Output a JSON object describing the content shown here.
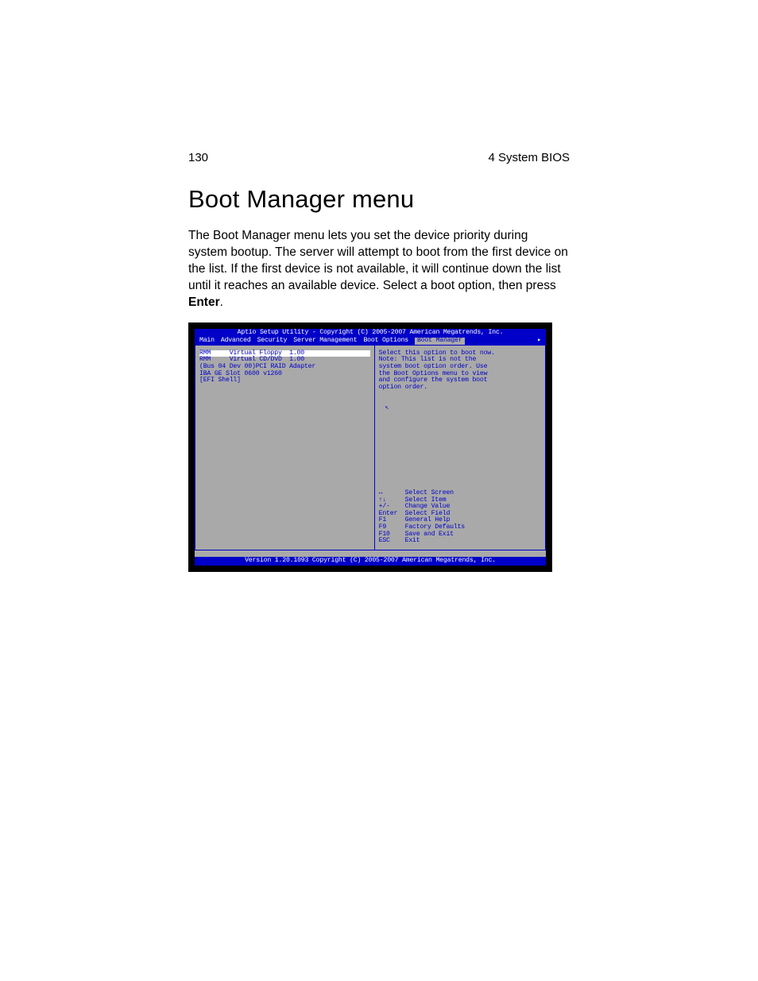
{
  "page": {
    "number": "130",
    "section": "4 System BIOS",
    "heading": "Boot Manager menu",
    "paragraph_pre": "The Boot Manager menu lets you set the device priority during system bootup. The server will attempt to boot from the first device on the list. If the first device is not available, it will continue down the list until it reaches an available device. Select a boot option, then press ",
    "paragraph_bold": "Enter",
    "paragraph_post": "."
  },
  "bios": {
    "title": "Aptio Setup Utility - Copyright (C) 2005-2007 American Megatrends, Inc.",
    "menu": {
      "items": [
        "Main",
        "Advanced",
        "Security",
        "Server Management",
        "Boot Options"
      ],
      "selected": "Boot Manager",
      "arrow": "▸"
    },
    "boot_options": [
      "RMM     Virtual Floppy  1.00",
      "RMM     Virtual CD/DVD  1.00",
      "(Bus 04 Dev 00)PCI RAID Adapter",
      "IBA GE Slot 0600 v1260",
      "[EFI Shell]"
    ],
    "help": "Select this option to boot now.\nNote: This list is not the\nsystem boot option order. Use\nthe Boot Options menu to view\nand configure the system boot\noption order.",
    "cursor_glyph": "↖",
    "keys": [
      {
        "k": "↔",
        "v": "Select Screen"
      },
      {
        "k": "↑↓",
        "v": "Select Item"
      },
      {
        "k": "+/-",
        "v": "Change Value"
      },
      {
        "k": "Enter",
        "v": "Select Field"
      },
      {
        "k": "F1",
        "v": "General Help"
      },
      {
        "k": "F9",
        "v": "Factory Defaults"
      },
      {
        "k": "F10",
        "v": "Save and Exit"
      },
      {
        "k": "ESC",
        "v": "Exit"
      }
    ],
    "footer": "Version 1.20.1093 Copyright (C) 2005-2007 American Megatrends, Inc."
  }
}
